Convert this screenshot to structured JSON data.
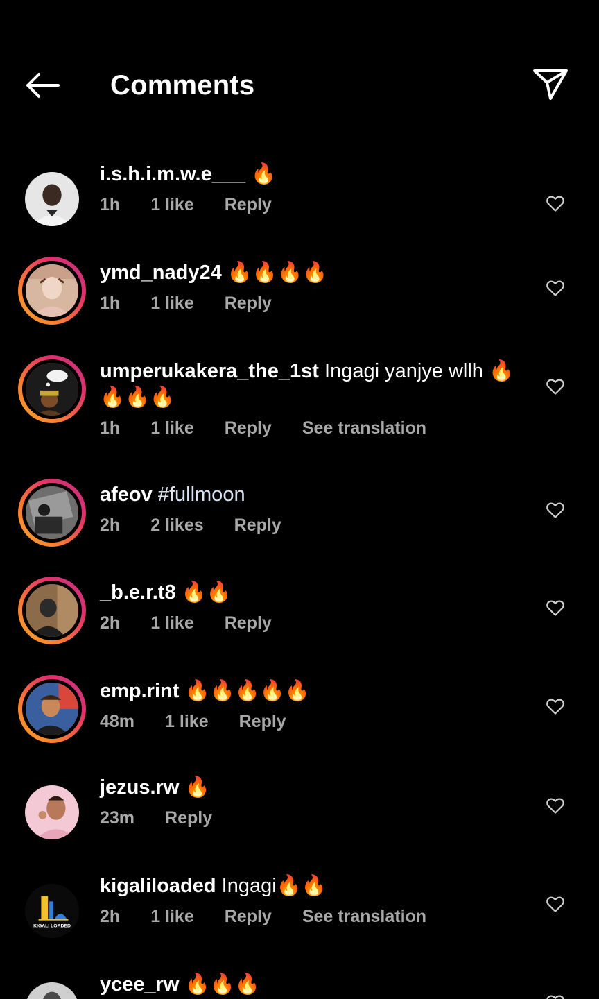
{
  "header": {
    "title": "Comments",
    "back_icon": "arrow-left-icon",
    "send_icon": "paper-plane-icon"
  },
  "colors": {
    "background": "#000000",
    "meta": "#a8a8a8",
    "ring_start": "#f9a825",
    "ring_end": "#c13584"
  },
  "comments": [
    {
      "username": "i.s.h.i.m.w.e___",
      "text": "🔥",
      "time": "1h",
      "likes": "1 like",
      "reply": "Reply",
      "translation": ""
    },
    {
      "username": "ymd_nady24",
      "text": "🔥🔥🔥🔥",
      "time": "1h",
      "likes": "1 like",
      "reply": "Reply",
      "translation": ""
    },
    {
      "username": "umperukakera_the_1st",
      "text": "Ingagi yanjye wllh 🔥🔥🔥🔥",
      "time": "1h",
      "likes": "1 like",
      "reply": "Reply",
      "translation": "See translation"
    },
    {
      "username": "afeov",
      "text": "#fullmoon",
      "time": "2h",
      "likes": "2 likes",
      "reply": "Reply",
      "translation": ""
    },
    {
      "username": "_b.e.r.t8",
      "text": "🔥🔥",
      "time": "2h",
      "likes": "1 like",
      "reply": "Reply",
      "translation": ""
    },
    {
      "username": "emp.rint",
      "text": "🔥🔥🔥🔥🔥",
      "time": "48m",
      "likes": "1 like",
      "reply": "Reply",
      "translation": ""
    },
    {
      "username": "jezus.rw",
      "text": "🔥",
      "time": "23m",
      "likes": "",
      "reply": "Reply",
      "translation": ""
    },
    {
      "username": "kigaliloaded",
      "text": "Ingagi🔥🔥",
      "time": "2h",
      "likes": "1 like",
      "reply": "Reply",
      "translation": "See translation",
      "avatar_text": "KIGALI LOADED"
    },
    {
      "username": "ycee_rw",
      "text": "🔥🔥🔥",
      "time": "",
      "likes": "",
      "reply": "",
      "translation": ""
    }
  ]
}
